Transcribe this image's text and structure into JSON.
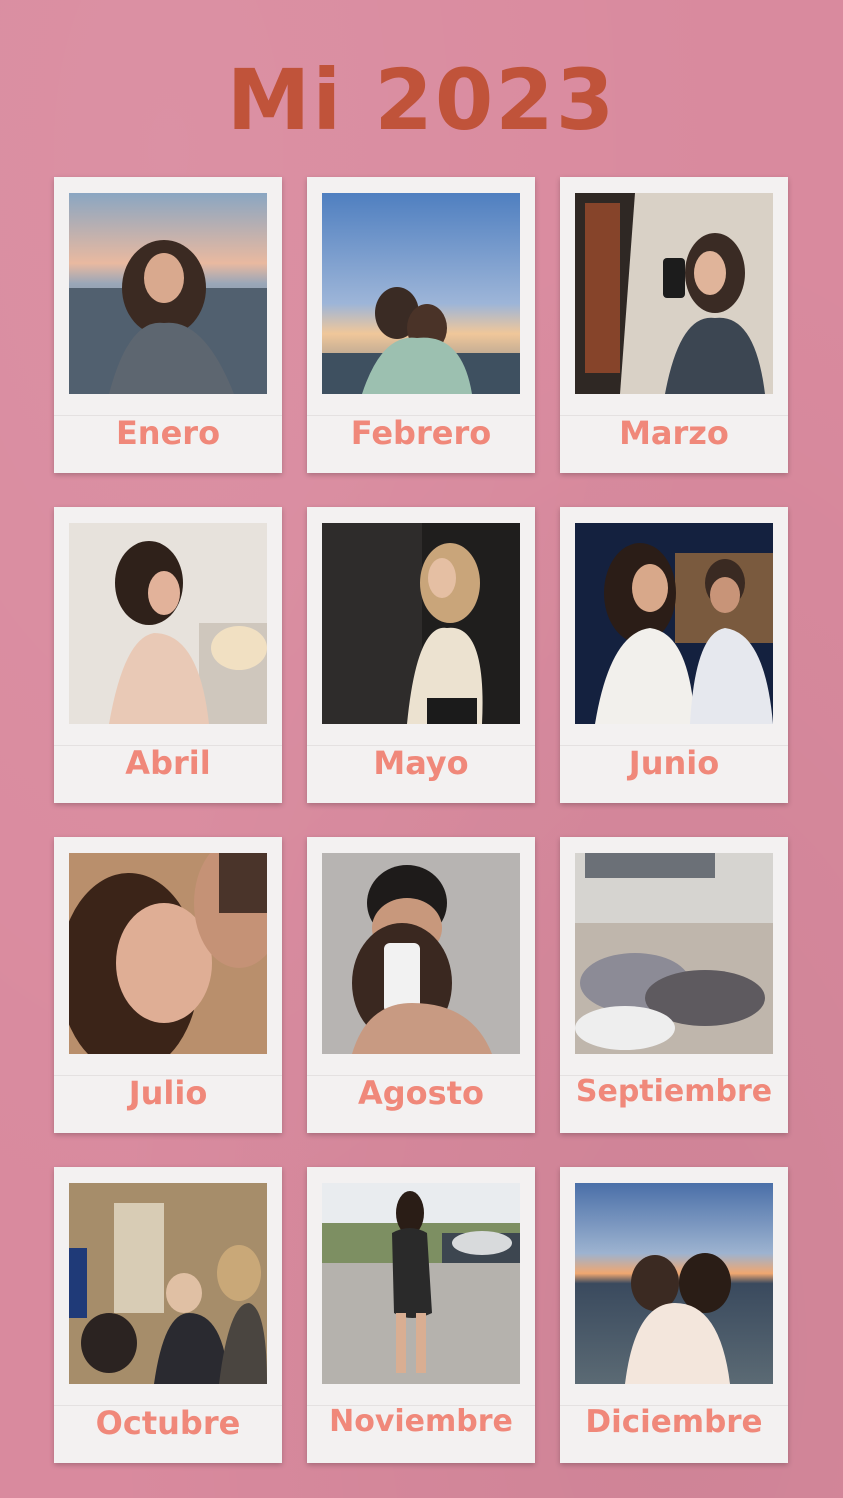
{
  "title": "Mi 2023",
  "colors": {
    "background": "#d98a9e",
    "title": "#c0533a",
    "label": "#f0887a",
    "card": "#f3f1f1"
  },
  "months": [
    {
      "label": "Enero",
      "photo": "woman-curly-hair-sunset-sea"
    },
    {
      "label": "Febrero",
      "photo": "two-friends-hugging-sunset"
    },
    {
      "label": "Marzo",
      "photo": "mirror-selfie-room"
    },
    {
      "label": "Abril",
      "photo": "woman-with-flowers"
    },
    {
      "label": "Mayo",
      "photo": "woman-white-top-dark-room"
    },
    {
      "label": "Junio",
      "photo": "couple-night-street"
    },
    {
      "label": "Julio",
      "photo": "couple-kiss-closeup"
    },
    {
      "label": "Agosto",
      "photo": "couple-mirror-selfie"
    },
    {
      "label": "Septiembre",
      "photo": "friends-sleeping-couch"
    },
    {
      "label": "Octubre",
      "photo": "friends-living-room"
    },
    {
      "label": "Noviembre",
      "photo": "woman-black-dress-street"
    },
    {
      "label": "Diciembre",
      "photo": "friends-hugging-beach-sunset"
    }
  ]
}
